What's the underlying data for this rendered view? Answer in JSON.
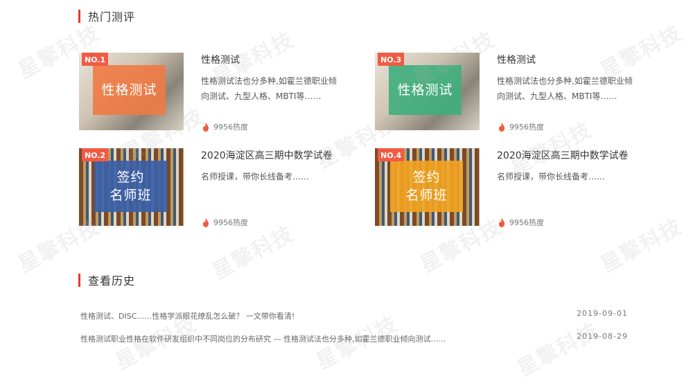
{
  "hot_section": {
    "title": "热门测评"
  },
  "cards": [
    {
      "badge": "NO.1",
      "overlay_lines": [
        "性格测试"
      ],
      "title": "性格测试",
      "desc": "性格测试法也分多种,如霍兰德职业倾向测试、九型人格、MBTI等……",
      "heat": "9956热度",
      "overlay_color": "#f07a45"
    },
    {
      "badge": "NO.3",
      "overlay_lines": [
        "性格测试"
      ],
      "title": "性格测试",
      "desc": "性格测试法也分多种,如霍兰德职业倾向测试、九型人格、MBTI等……",
      "heat": "9956热度",
      "overlay_color": "#3fae7d"
    },
    {
      "badge": "NO.2",
      "overlay_lines": [
        "签约",
        "名师班"
      ],
      "title": "2020海淀区高三期中数学试卷",
      "desc": "名师授课，带你长线备考……",
      "heat": "9956热度",
      "overlay_color": "#3a5fa8"
    },
    {
      "badge": "NO.4",
      "overlay_lines": [
        "签约",
        "名师班"
      ],
      "title": "2020海淀区高三期中数学试卷",
      "desc": "名师授课，带你长线备考……",
      "heat": "9956热度",
      "overlay_color": "#f0a321"
    }
  ],
  "history_section": {
    "title": "查看历史"
  },
  "history": [
    {
      "text": "性格测试、DISC……性格学派眼花缭乱怎么破？ 一文带你看清!",
      "date": "2019-09-01"
    },
    {
      "text": "性格测试职业性格在软件研发组织中不同岗位的分布研究 — 性格测试法也分多种,如霍兰德职业倾向测试……",
      "date": "2019-08-29"
    }
  ],
  "watermark": "星擎科技",
  "colors": {
    "accent": "#e8372f",
    "badge": "#f15a43",
    "flame": "#f05a3a"
  }
}
